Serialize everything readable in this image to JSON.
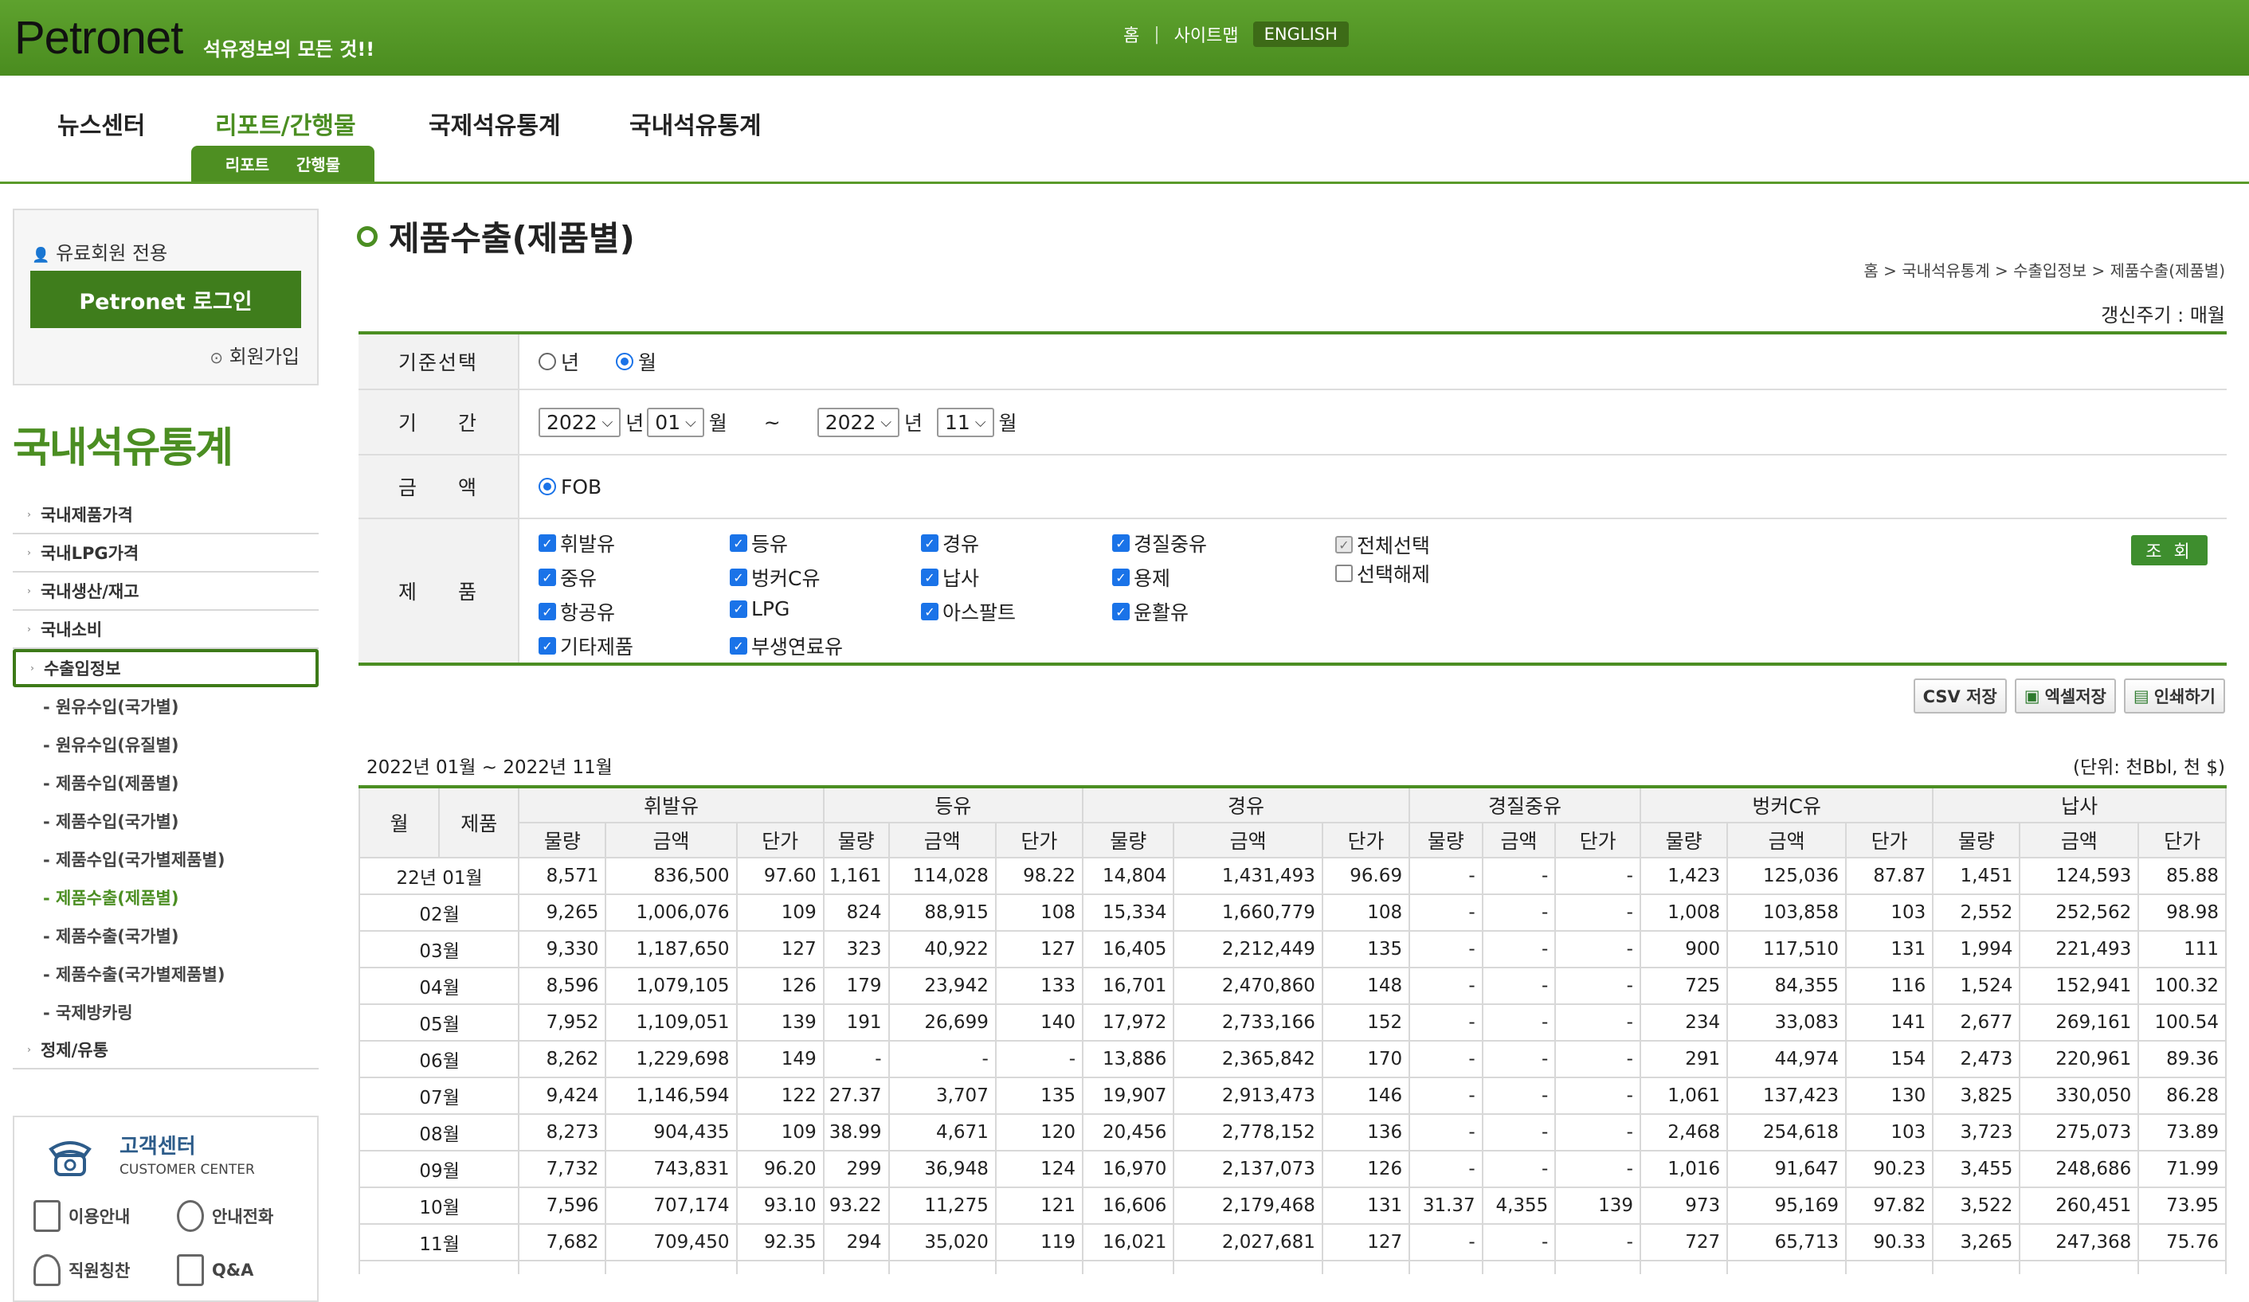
{
  "header": {
    "logo": "Petronet",
    "tagline": "석유정보의 모든 것!!",
    "links": [
      "홈",
      "사이트맵"
    ],
    "english": "ENGLISH"
  },
  "nav": {
    "items": [
      "뉴스센터",
      "리포트/간행물",
      "국제석유통계",
      "국내석유통계"
    ],
    "subtabs": [
      "리포트",
      "간행물"
    ]
  },
  "sidebar": {
    "member_label": "유료회원 전용",
    "login_button": "Petronet 로그인",
    "join_link": "회원가입",
    "section_title": "국내석유통계",
    "menu": [
      "국내제품가격",
      "국내LPG가격",
      "국내생산/재고",
      "국내소비",
      "수출입정보"
    ],
    "submenu": [
      "- 원유수입(국가별)",
      "- 원유수입(유질별)",
      "- 제품수입(제품별)",
      "- 제품수입(국가별)",
      "- 제품수입(국가별제품별)",
      "- 제품수출(제품별)",
      "- 제품수출(국가별)",
      "- 제품수출(국가별제품별)",
      "- 국제방카링"
    ],
    "last_menu": "정제/유통",
    "customer_center": {
      "title": "고객센터",
      "subtitle": "CUSTOMER CENTER",
      "items": [
        "이용안내",
        "안내전화",
        "직원칭찬",
        "Q&A"
      ]
    }
  },
  "page": {
    "title": "제품수출(제품별)",
    "breadcrumb": "홈 > 국내석유통계 > 수출입정보 > 제품수출(제품별)",
    "cycle": "갱신주기 : 매월"
  },
  "filter": {
    "basis_label": "기준선택",
    "basis_options": [
      "년",
      "월"
    ],
    "period_label": "기 간",
    "from_year": "2022",
    "from_month": "01",
    "to_year": "2022",
    "to_month": "11",
    "year_word": "년",
    "month_word": "월",
    "tilde": "~",
    "amount_label": "금 액",
    "amount_option": "FOB",
    "product_label": "제 품",
    "products": [
      "휘발유",
      "등유",
      "경유",
      "경질중유",
      "중유",
      "벙커C유",
      "납사",
      "용제",
      "항공유",
      "LPG",
      "아스팔트",
      "윤활유",
      "기타제품",
      "부생연료유"
    ],
    "select_all": "전체선택",
    "deselect_all": "선택해제",
    "search_button": "조 회"
  },
  "tools": [
    "CSV 저장",
    "엑셀저장",
    "인쇄하기"
  ],
  "table": {
    "period_text": "2022년 01월 ~ 2022년 11월",
    "unit_text": "(단위: 천Bbl, 천 $)",
    "col_month": "월",
    "col_product": "제품",
    "groups": [
      "휘발유",
      "등유",
      "경유",
      "경질중유",
      "벙커C유",
      "납사"
    ],
    "subcols": [
      "물량",
      "금액",
      "단가"
    ],
    "rows": [
      [
        "22년 01월",
        "8,571",
        "836,500",
        "97.60",
        "1,161",
        "114,028",
        "98.22",
        "14,804",
        "1,431,493",
        "96.69",
        "-",
        "-",
        "-",
        "1,423",
        "125,036",
        "87.87",
        "1,451",
        "124,593",
        "85.88"
      ],
      [
        "02월",
        "9,265",
        "1,006,076",
        "109",
        "824",
        "88,915",
        "108",
        "15,334",
        "1,660,779",
        "108",
        "-",
        "-",
        "-",
        "1,008",
        "103,858",
        "103",
        "2,552",
        "252,562",
        "98.98"
      ],
      [
        "03월",
        "9,330",
        "1,187,650",
        "127",
        "323",
        "40,922",
        "127",
        "16,405",
        "2,212,449",
        "135",
        "-",
        "-",
        "-",
        "900",
        "117,510",
        "131",
        "1,994",
        "221,493",
        "111"
      ],
      [
        "04월",
        "8,596",
        "1,079,105",
        "126",
        "179",
        "23,942",
        "133",
        "16,701",
        "2,470,860",
        "148",
        "-",
        "-",
        "-",
        "725",
        "84,355",
        "116",
        "1,524",
        "152,941",
        "100.32"
      ],
      [
        "05월",
        "7,952",
        "1,109,051",
        "139",
        "191",
        "26,699",
        "140",
        "17,972",
        "2,733,166",
        "152",
        "-",
        "-",
        "-",
        "234",
        "33,083",
        "141",
        "2,677",
        "269,161",
        "100.54"
      ],
      [
        "06월",
        "8,262",
        "1,229,698",
        "149",
        "-",
        "-",
        "-",
        "13,886",
        "2,365,842",
        "170",
        "-",
        "-",
        "-",
        "291",
        "44,974",
        "154",
        "2,473",
        "220,961",
        "89.36"
      ],
      [
        "07월",
        "9,424",
        "1,146,594",
        "122",
        "27.37",
        "3,707",
        "135",
        "19,907",
        "2,913,473",
        "146",
        "-",
        "-",
        "-",
        "1,061",
        "137,423",
        "130",
        "3,825",
        "330,050",
        "86.28"
      ],
      [
        "08월",
        "8,273",
        "904,435",
        "109",
        "38.99",
        "4,671",
        "120",
        "20,456",
        "2,778,152",
        "136",
        "-",
        "-",
        "-",
        "2,468",
        "254,618",
        "103",
        "3,723",
        "275,073",
        "73.89"
      ],
      [
        "09월",
        "7,732",
        "743,831",
        "96.20",
        "299",
        "36,948",
        "124",
        "16,970",
        "2,137,073",
        "126",
        "-",
        "-",
        "-",
        "1,016",
        "91,647",
        "90.23",
        "3,455",
        "248,686",
        "71.99"
      ],
      [
        "10월",
        "7,596",
        "707,174",
        "93.10",
        "93.22",
        "11,275",
        "121",
        "16,606",
        "2,179,468",
        "131",
        "31.37",
        "4,355",
        "139",
        "973",
        "95,169",
        "97.82",
        "3,522",
        "260,451",
        "73.95"
      ],
      [
        "11월",
        "7,682",
        "709,450",
        "92.35",
        "294",
        "35,020",
        "119",
        "16,021",
        "2,027,681",
        "127",
        "-",
        "-",
        "-",
        "727",
        "65,713",
        "90.33",
        "3,265",
        "247,368",
        "75.76"
      ]
    ]
  }
}
